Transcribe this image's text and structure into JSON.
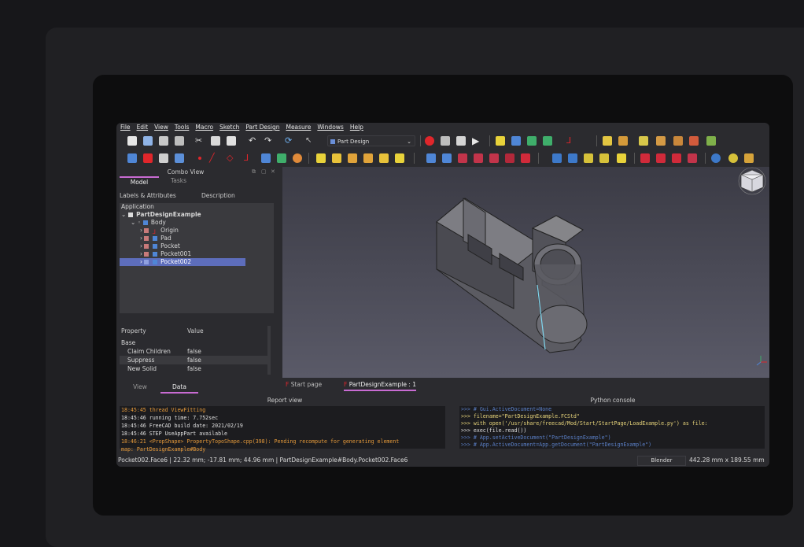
{
  "menu": [
    "File",
    "Edit",
    "View",
    "Tools",
    "Macro",
    "Sketch",
    "Part Design",
    "Measure",
    "Windows",
    "Help"
  ],
  "workbench_select": "Part Design",
  "combo": {
    "title": "Combo View",
    "tabs": [
      "Model",
      "Tasks"
    ],
    "tree_headers": [
      "Labels & Attributes",
      "Description"
    ],
    "application_label": "Application",
    "tree": [
      {
        "label": "PartDesignExample",
        "indent": 0,
        "bold": true
      },
      {
        "label": "Body",
        "indent": 1
      },
      {
        "label": "Origin",
        "indent": 2
      },
      {
        "label": "Pad",
        "indent": 2
      },
      {
        "label": "Pocket",
        "indent": 2
      },
      {
        "label": "Pocket001",
        "indent": 2
      },
      {
        "label": "Pocket002",
        "indent": 2,
        "selected": true
      }
    ],
    "prop_headers": [
      "Property",
      "Value"
    ],
    "prop_group": "Base",
    "properties": [
      {
        "name": "Claim Children",
        "value": "false"
      },
      {
        "name": "Suppress",
        "value": "false"
      },
      {
        "name": "New Solid",
        "value": "false"
      }
    ],
    "view_tabs": [
      "View",
      "Data"
    ]
  },
  "doc_tabs": [
    "Start page",
    "PartDesignExample : 1"
  ],
  "report": {
    "title": "Report view",
    "lines": [
      {
        "text": "18:45:45  thread ViewFitting",
        "color": "#e69a3a"
      },
      {
        "text": "18:45:46  running time: 7.752sec",
        "color": "#e0e0e0"
      },
      {
        "text": "18:45:46  FreeCAD build date: 2021/02/19",
        "color": "#e0e0e0"
      },
      {
        "text": "18:45:46  STEP UseAppPart available",
        "color": "#e0e0e0"
      },
      {
        "text": "18:46:21  <PropShape> PropertyTopoShape.cpp(398): Pending recompute for generating element",
        "color": "#e69a3a"
      },
      {
        "text": "map: PartDesignExample#Body",
        "color": "#e69a3a"
      }
    ]
  },
  "python": {
    "title": "Python console",
    "lines": [
      ">>> # Gui.ActiveDocument=None",
      ">>> filename=\"PartDesignExample.FCStd\"",
      ">>> with open('/usr/share/freecad/Mod/Start/StartPage/LoadExample.py') as file:",
      ">>>        exec(file.read())",
      ">>> # App.setActiveDocument(\"PartDesignExample\")",
      ">>> # App.ActiveDocument=App.getDocument(\"PartDesignExample\")"
    ]
  },
  "status": {
    "left": "Pocket002.Face6 | 22.32 mm; -17.81 mm; 44.96 mm | PartDesignExample#Body.Pocket002.Face6",
    "nav": "Blender",
    "dims": "442.28 mm x 189.55 mm"
  },
  "colors": {
    "accent": "#c86bd2",
    "selection": "#5d6dbb",
    "record": "#e0262b"
  }
}
